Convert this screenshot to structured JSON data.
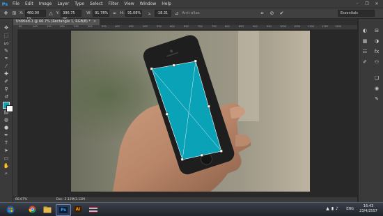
{
  "app": {
    "logo": "Ps"
  },
  "menu": [
    "File",
    "Edit",
    "Image",
    "Layer",
    "Type",
    "Select",
    "Filter",
    "View",
    "Window",
    "Help"
  ],
  "window_controls": {
    "minimize": "–",
    "restore": "❐",
    "close": "✕"
  },
  "options": {
    "x_label": "X:",
    "x_value": "460.00 px",
    "y_label": "Y:",
    "y_value": "396.75 px",
    "w_label": "W:",
    "w_value": "91.78%",
    "h_label": "H:",
    "h_value": "91.08%",
    "angle_value": "-18.31",
    "antialias_label": "Anti-alias",
    "workspace": "Essentials"
  },
  "document": {
    "tab_title": "Untitled-1 @ 66.7% (Rectangle 1, RGB/8) *",
    "close": "×",
    "ruler_ticks": [
      "50",
      "100",
      "150",
      "200",
      "250",
      "300",
      "350",
      "400",
      "450",
      "500",
      "550",
      "600",
      "650",
      "700",
      "750",
      "800",
      "850",
      "900",
      "950",
      "1000",
      "1050",
      "1100",
      "1150",
      "1200"
    ]
  },
  "status": {
    "zoom": "66.67%",
    "doc": "Doc: 3.12M/3.12M"
  },
  "taskbar": {
    "apps": [
      {
        "name": "chrome",
        "label": ""
      },
      {
        "name": "explorer",
        "label": ""
      },
      {
        "name": "photoshop",
        "label": "Ps"
      },
      {
        "name": "illustrator",
        "label": "Ai"
      },
      {
        "name": "flag",
        "label": ""
      }
    ],
    "language": "ENG",
    "time": "16:43",
    "date": "23/4/2557"
  },
  "colors": {
    "accent": "#0aa2b6",
    "foreground": "#0aa2b6",
    "background": "#ffffff"
  }
}
